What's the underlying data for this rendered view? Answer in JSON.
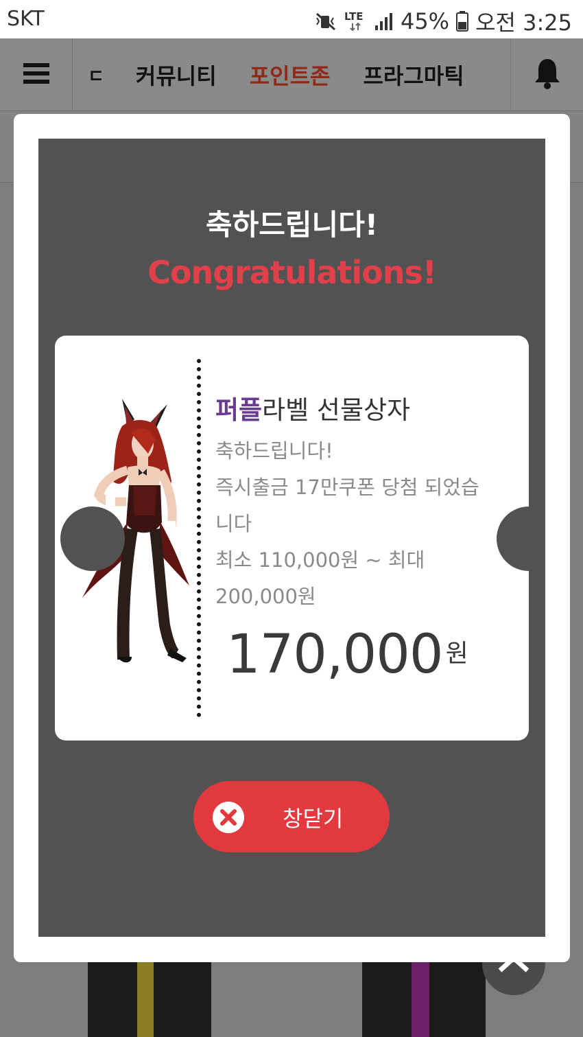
{
  "status_bar": {
    "carrier": "SKT",
    "network": "LTE",
    "battery": "45%",
    "time": "오전 3:25",
    "icons": [
      "mute-vibrate-icon",
      "lte-icon",
      "signal-icon",
      "battery-icon"
    ]
  },
  "header": {
    "menu_icon": "hamburger-icon",
    "tabs": [
      {
        "label": "ㄷ",
        "active": false
      },
      {
        "label": "커뮤니티",
        "active": false
      },
      {
        "label": "포인트존",
        "active": true
      },
      {
        "label": "프라그마틱",
        "active": false
      }
    ],
    "bell_icon": "bell-icon"
  },
  "modal": {
    "title_ko": "축하드립니다!",
    "title_en": "Congratulations!",
    "ticket": {
      "title_highlight": "퍼플",
      "title_rest": "라벨 선물상자",
      "lines": [
        "축하드립니다!",
        "즉시출금 17만쿠폰 당첨 되었습",
        "니다",
        "최소 110,000원 ~ 최대",
        "200,000원"
      ],
      "amount": "170,000",
      "amount_unit": "원"
    },
    "close_label": "창닫기",
    "close_icon": "close-x-icon"
  },
  "colors": {
    "accent_red": "#e2393f",
    "congrats_red": "#e0404a",
    "purple": "#6a3a8f",
    "active_tab": "#8e2a16"
  }
}
